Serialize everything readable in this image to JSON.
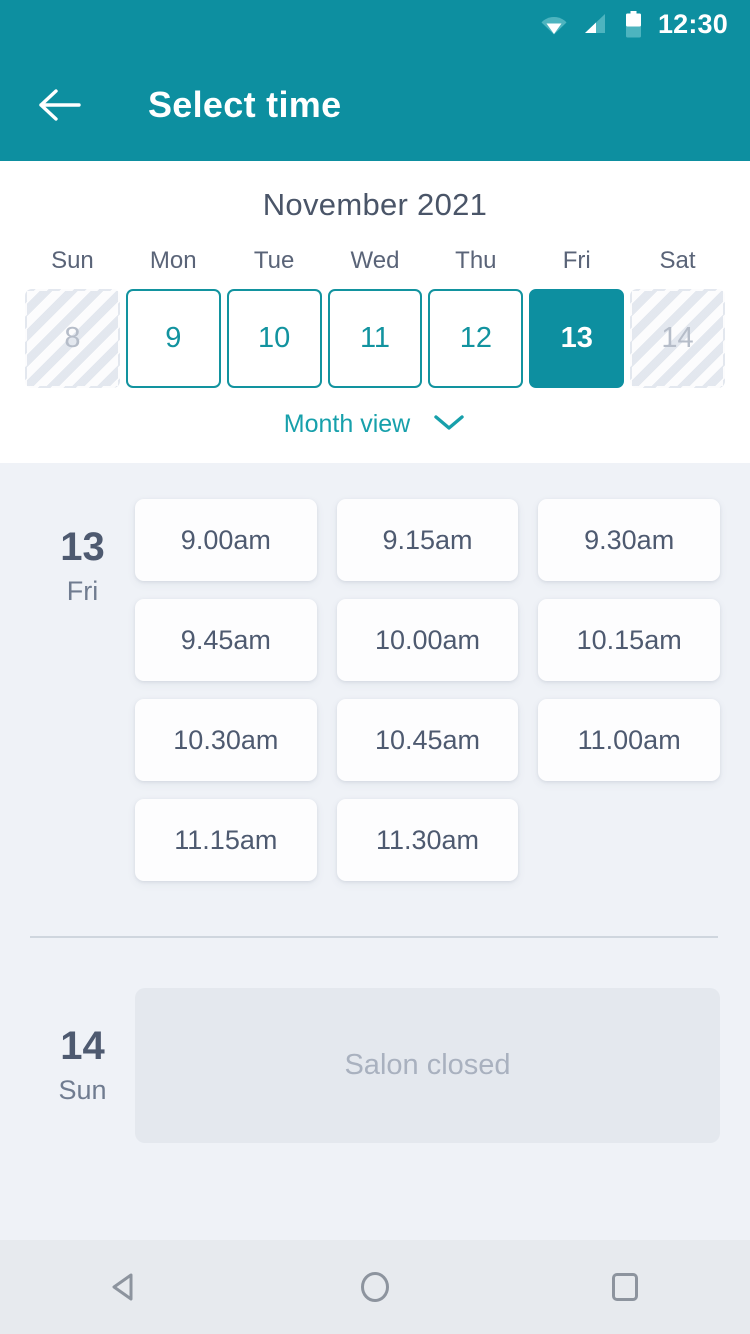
{
  "statusbar": {
    "time": "12:30",
    "icons": [
      "wifi-icon",
      "cellular-signal-icon",
      "battery-icon"
    ]
  },
  "appbar": {
    "title": "Select time",
    "back_icon": "arrow-left-icon",
    "background": "#0d8fa0"
  },
  "calendar": {
    "month_title": "November 2021",
    "weekdays": [
      "Sun",
      "Mon",
      "Tue",
      "Wed",
      "Thu",
      "Fri",
      "Sat"
    ],
    "days": [
      {
        "num": "8",
        "state": "disabled"
      },
      {
        "num": "9",
        "state": "enabled"
      },
      {
        "num": "10",
        "state": "enabled"
      },
      {
        "num": "11",
        "state": "enabled"
      },
      {
        "num": "12",
        "state": "enabled"
      },
      {
        "num": "13",
        "state": "selected"
      },
      {
        "num": "14",
        "state": "disabled"
      }
    ],
    "month_view_label": "Month view",
    "month_view_icon": "chevron-down-icon",
    "accent_color": "#0d8fa0"
  },
  "schedule": [
    {
      "day_num": "13",
      "day_name": "Fri",
      "slots": [
        "9.00am",
        "9.15am",
        "9.30am",
        "9.45am",
        "10.00am",
        "10.15am",
        "10.30am",
        "10.45am",
        "11.00am",
        "11.15am",
        "11.30am"
      ]
    },
    {
      "day_num": "14",
      "day_name": "Sun",
      "closed_label": "Salon closed"
    }
  ],
  "navbar": {
    "back": "nav-back-icon",
    "home": "nav-home-icon",
    "recents": "nav-recents-icon"
  }
}
